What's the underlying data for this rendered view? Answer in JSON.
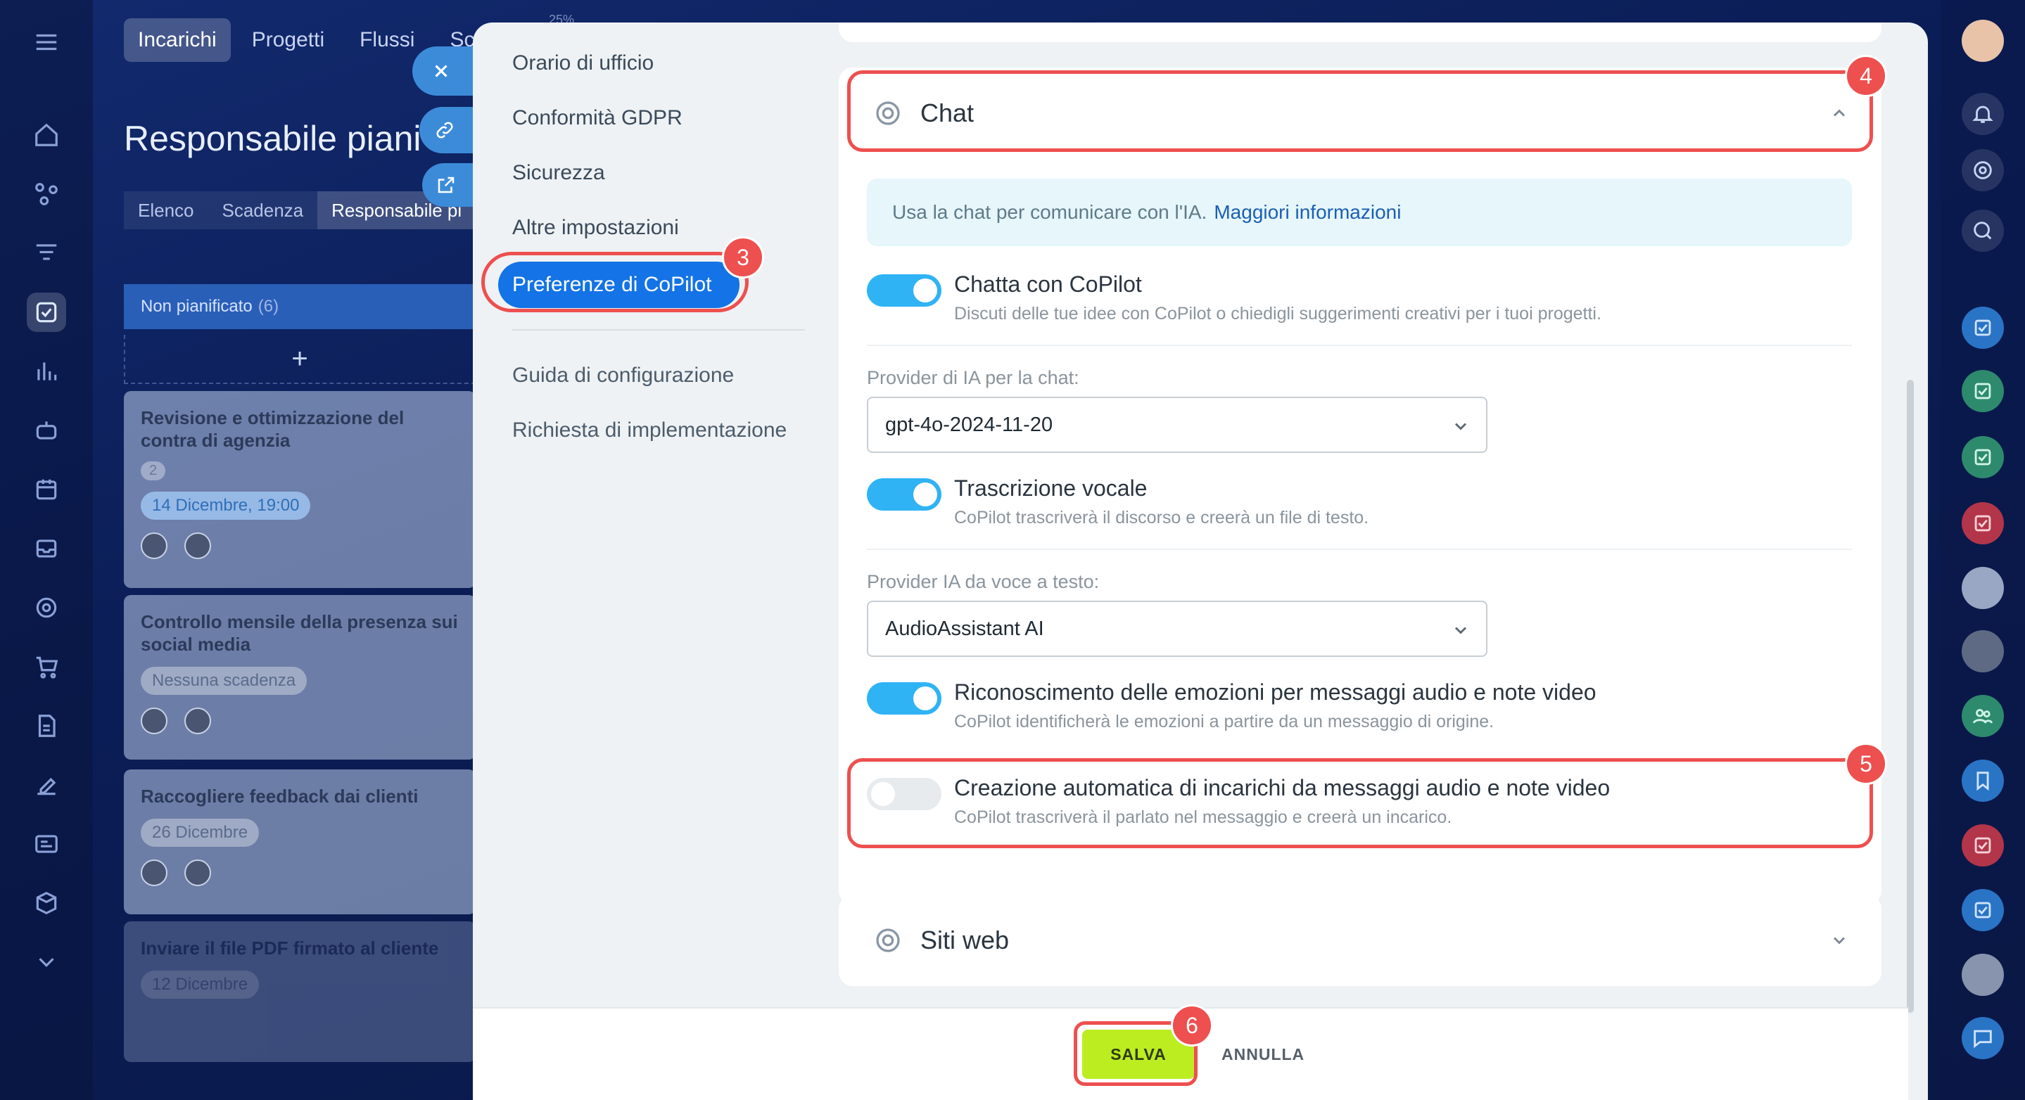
{
  "background": {
    "top_tabs": [
      "Incarichi",
      "Progetti",
      "Flussi",
      "Sc"
    ],
    "zoom_badge": "25%",
    "title": "Responsabile piani",
    "sub_tabs": [
      "Elenco",
      "Scadenza",
      "Responsabile pi"
    ],
    "kanban": {
      "column_title": "Non pianificato",
      "column_count": "(6)",
      "add_symbol": "+",
      "cards": [
        {
          "title": "Revisione e ottimizzazione del contra di agenzia",
          "badge": "2",
          "chip": "14 Dicembre, 19:00"
        },
        {
          "title": "Controllo mensile della presenza sui social media",
          "chip": "Nessuna scadenza"
        },
        {
          "title": "Raccogliere feedback dai clienti",
          "chip": "26 Dicembre"
        },
        {
          "title": "Inviare il file PDF firmato al cliente",
          "chip": "12 Dicembre"
        }
      ]
    }
  },
  "settings_nav": {
    "items": [
      "Orario di ufficio",
      "Conformità GDPR",
      "Sicurezza",
      "Altre impostazioni"
    ],
    "active": "Preferenze di CoPilot",
    "secondary": [
      "Guida di configurazione",
      "Richiesta di implementazione"
    ]
  },
  "chat_section": {
    "title": "Chat",
    "info_text": "Usa la chat per comunicare con l'IA.",
    "info_link": "Maggiori informazioni",
    "toggles": [
      {
        "label": "Chatta con CoPilot",
        "desc": "Discuti delle tue idee con CoPilot o chiedigli suggerimenti creativi per i tuoi progetti.",
        "on": true
      },
      {
        "label": "Trascrizione vocale",
        "desc": "CoPilot trascriverà il discorso e creerà un file di testo.",
        "on": true
      },
      {
        "label": "Riconoscimento delle emozioni per messaggi audio e note video",
        "desc": "CoPilot identificherà le emozioni a partire da un messaggio di origine.",
        "on": true
      },
      {
        "label": "Creazione automatica di incarichi da messaggi audio e note video",
        "desc": "CoPilot trascriverà il parlato nel messaggio e creerà un incarico.",
        "on": false
      }
    ],
    "chat_provider_label": "Provider di IA per la chat:",
    "chat_provider_value": "gpt-4o-2024-11-20",
    "voice_provider_label": "Provider IA da voce a testo:",
    "voice_provider_value": "AudioAssistant AI"
  },
  "websites_section": {
    "title": "Siti web"
  },
  "footer": {
    "save": "SALVA",
    "cancel": "ANNULLA"
  },
  "annotations": [
    "3",
    "4",
    "5",
    "6"
  ],
  "colors": {
    "accent": "#1473e6",
    "toggle_on": "#2fb3f4",
    "save": "#bbed21",
    "annotation": "#ee4f4f"
  }
}
